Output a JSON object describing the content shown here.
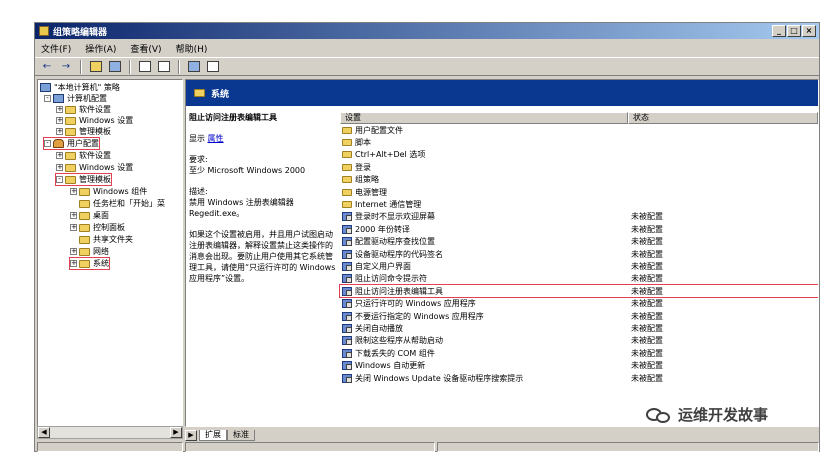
{
  "window": {
    "title": "组策略编辑器",
    "controls": [
      "_",
      "□",
      "×"
    ]
  },
  "menu": [
    "文件(F)",
    "操作(A)",
    "查看(V)",
    "帮助(H)"
  ],
  "toolbar": {
    "back": "←",
    "forward": "→"
  },
  "tree": {
    "root": "\"本地计算机\" 策略",
    "computer_config": "计算机配置",
    "cc_software": "软件设置",
    "cc_windows": "Windows 设置",
    "cc_admin": "管理模板",
    "user_config": "用户配置",
    "uc_software": "软件设置",
    "uc_windows": "Windows 设置",
    "uc_admin": "管理模板",
    "win_components": "Windows 组件",
    "taskbar": "任务栏和「开始」菜",
    "desktop": "桌面",
    "control_panel": "控制面板",
    "shared_folders": "共享文件夹",
    "network": "网络",
    "system": "系统"
  },
  "right": {
    "header": "系统",
    "desc_title": "阻止访问注册表编辑工具",
    "show_label": "显示",
    "show_link": "属性",
    "req_label": "要求:",
    "req_text": "至少 Microsoft Windows 2000",
    "desc_label": "描述:",
    "desc_text": "禁用 Windows 注册表编辑器 Regedit.exe。",
    "desc_body": "如果这个设置被启用，并且用户试图启动注册表编辑器，解释设置禁止这类操作的消息会出现。要防止用户使用其它系统管理工具，请使用“只运行许可的 Windows 应用程序”设置。",
    "col_setting": "设置",
    "col_state": "状态",
    "folders": [
      "用户配置文件",
      "脚本",
      "Ctrl+Alt+Del 选项",
      "登录",
      "组策略",
      "电源管理",
      "Internet 通信管理"
    ],
    "policies": [
      {
        "name": "登录时不显示欢迎屏幕",
        "state": "未被配置"
      },
      {
        "name": "2000 年份转译",
        "state": "未被配置"
      },
      {
        "name": "配置驱动程序查找位置",
        "state": "未被配置"
      },
      {
        "name": "设备驱动程序的代码签名",
        "state": "未被配置"
      },
      {
        "name": "自定义用户界面",
        "state": "未被配置"
      },
      {
        "name": "阻止访问命令提示符",
        "state": "未被配置"
      },
      {
        "name": "阻止访问注册表编辑工具",
        "state": "未被配置"
      },
      {
        "name": "只运行许可的 Windows 应用程序",
        "state": "未被配置"
      },
      {
        "name": "不要运行指定的 Windows 应用程序",
        "state": "未被配置"
      },
      {
        "name": "关闭自动播放",
        "state": "未被配置"
      },
      {
        "name": "限制这些程序从帮助启动",
        "state": "未被配置"
      },
      {
        "name": "下载丢失的 COM 组件",
        "state": "未被配置"
      },
      {
        "name": "Windows 自动更新",
        "state": "未被配置"
      },
      {
        "name": "关闭 Windows Update 设备驱动程序搜索提示",
        "state": "未被配置"
      }
    ]
  },
  "tabs": [
    "扩展",
    "标准"
  ],
  "watermark": "运维开发故事"
}
